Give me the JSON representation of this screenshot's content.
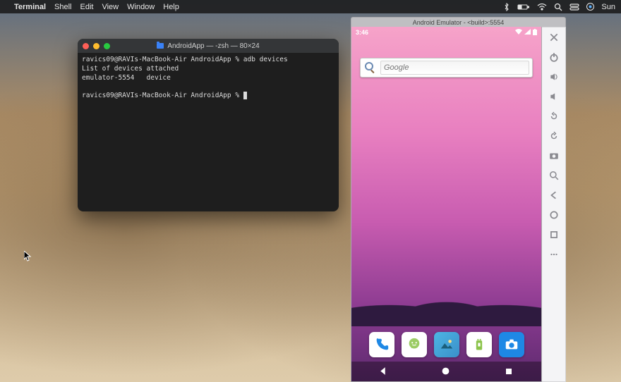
{
  "menubar": {
    "app": "Terminal",
    "items": [
      "Shell",
      "Edit",
      "View",
      "Window",
      "Help"
    ],
    "clock": "Sun"
  },
  "terminal": {
    "title": "AndroidApp — -zsh — 80×24",
    "traffic_colors": {
      "close": "#ff5f57",
      "min": "#ffbd2e",
      "max": "#28c940"
    },
    "lines": [
      "ravics09@RAVIs-MacBook-Air AndroidApp % adb devices",
      "List of devices attached",
      "emulator-5554   device",
      "",
      "ravics09@RAVIs-MacBook-Air AndroidApp % "
    ]
  },
  "emulator": {
    "window_title": "Android Emulator - <build>:5554",
    "status_time": "3:46",
    "search_placeholder": "Google",
    "sidebar_buttons": [
      "close",
      "power",
      "volume-up",
      "volume-down",
      "rotate-left",
      "rotate-right",
      "screenshot",
      "zoom",
      "back",
      "home",
      "overview",
      "more"
    ],
    "dock_apps": [
      "phone",
      "messages",
      "photos",
      "play-store",
      "camera"
    ],
    "nav_buttons": [
      "back",
      "home",
      "overview"
    ]
  }
}
